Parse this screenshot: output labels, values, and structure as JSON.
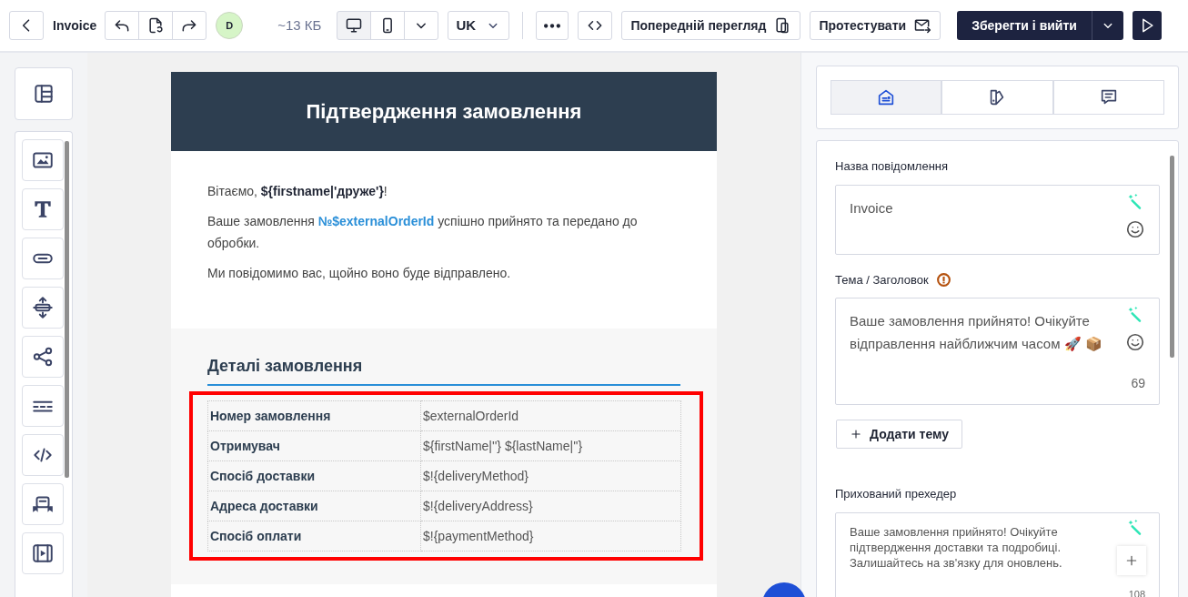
{
  "toolbar": {
    "title": "Invoice",
    "avatar": "D",
    "size": "~13 КБ",
    "view_modes": [
      {
        "kind": "desktop",
        "selected": true
      },
      {
        "kind": "mobile",
        "selected": false
      }
    ],
    "language": "UK",
    "buttons": [
      {
        "kind": "preview",
        "label": "Попередній перегляд"
      },
      {
        "kind": "test",
        "label": "Протестувати"
      }
    ],
    "save": "Зберегти і вийти"
  },
  "blocks": [
    {
      "kind": "image"
    },
    {
      "kind": "text"
    },
    {
      "kind": "button"
    },
    {
      "kind": "spacer"
    },
    {
      "kind": "social"
    },
    {
      "kind": "divider"
    },
    {
      "kind": "html"
    },
    {
      "kind": "banner"
    },
    {
      "kind": "video"
    }
  ],
  "email": {
    "header": "Підтвердження замовлення",
    "greeting": "Вітаємо, **${firstname|'друже'}**!",
    "message_before": "Ваше замовлення",
    "order_link": "№$externalOrderId",
    "message_after": "успішно прийнято та передано до обробки.",
    "notice": "Ми повідомимо вас, щойно воно буде відправлено.",
    "details_title": "Деталі замовлення",
    "details": {
      "selected": true,
      "rows": [
        {
          "label": "Номер замовлення",
          "value": "$externalOrderId"
        },
        {
          "label": "Отримувач",
          "value": "${firstName|''} ${lastName|''}"
        },
        {
          "label": "Спосіб доставки",
          "value": "$!{deliveryMethod}"
        },
        {
          "label": "Адреса доставки",
          "value": "$!{deliveryAddress}"
        },
        {
          "label": "Спосіб оплати",
          "value": "$!{paymentMethod}"
        }
      ]
    }
  },
  "settings": {
    "tabs": [
      {
        "kind": "envelope",
        "selected": true
      },
      {
        "kind": "palette",
        "selected": false
      },
      {
        "kind": "comment",
        "selected": false
      }
    ],
    "fields": [
      {
        "label": "Назва повідомлення",
        "value": "Invoice",
        "warning": false
      },
      {
        "label": "Тема / Заголовок",
        "value": "Ваше замовлення прийнято! Очікуйте відправлення найближчим часом 🚀 📦",
        "counter": "69",
        "warning": true
      }
    ],
    "add_subject": "Додати тему",
    "preheader": {
      "label": "Прихований прехедер",
      "value": "Ваше замовлення прийнято! Очікуйте підтвердження доставки та подробиці. Залишайтесь на зв'язку для оновлень.",
      "counter": "108"
    }
  }
}
